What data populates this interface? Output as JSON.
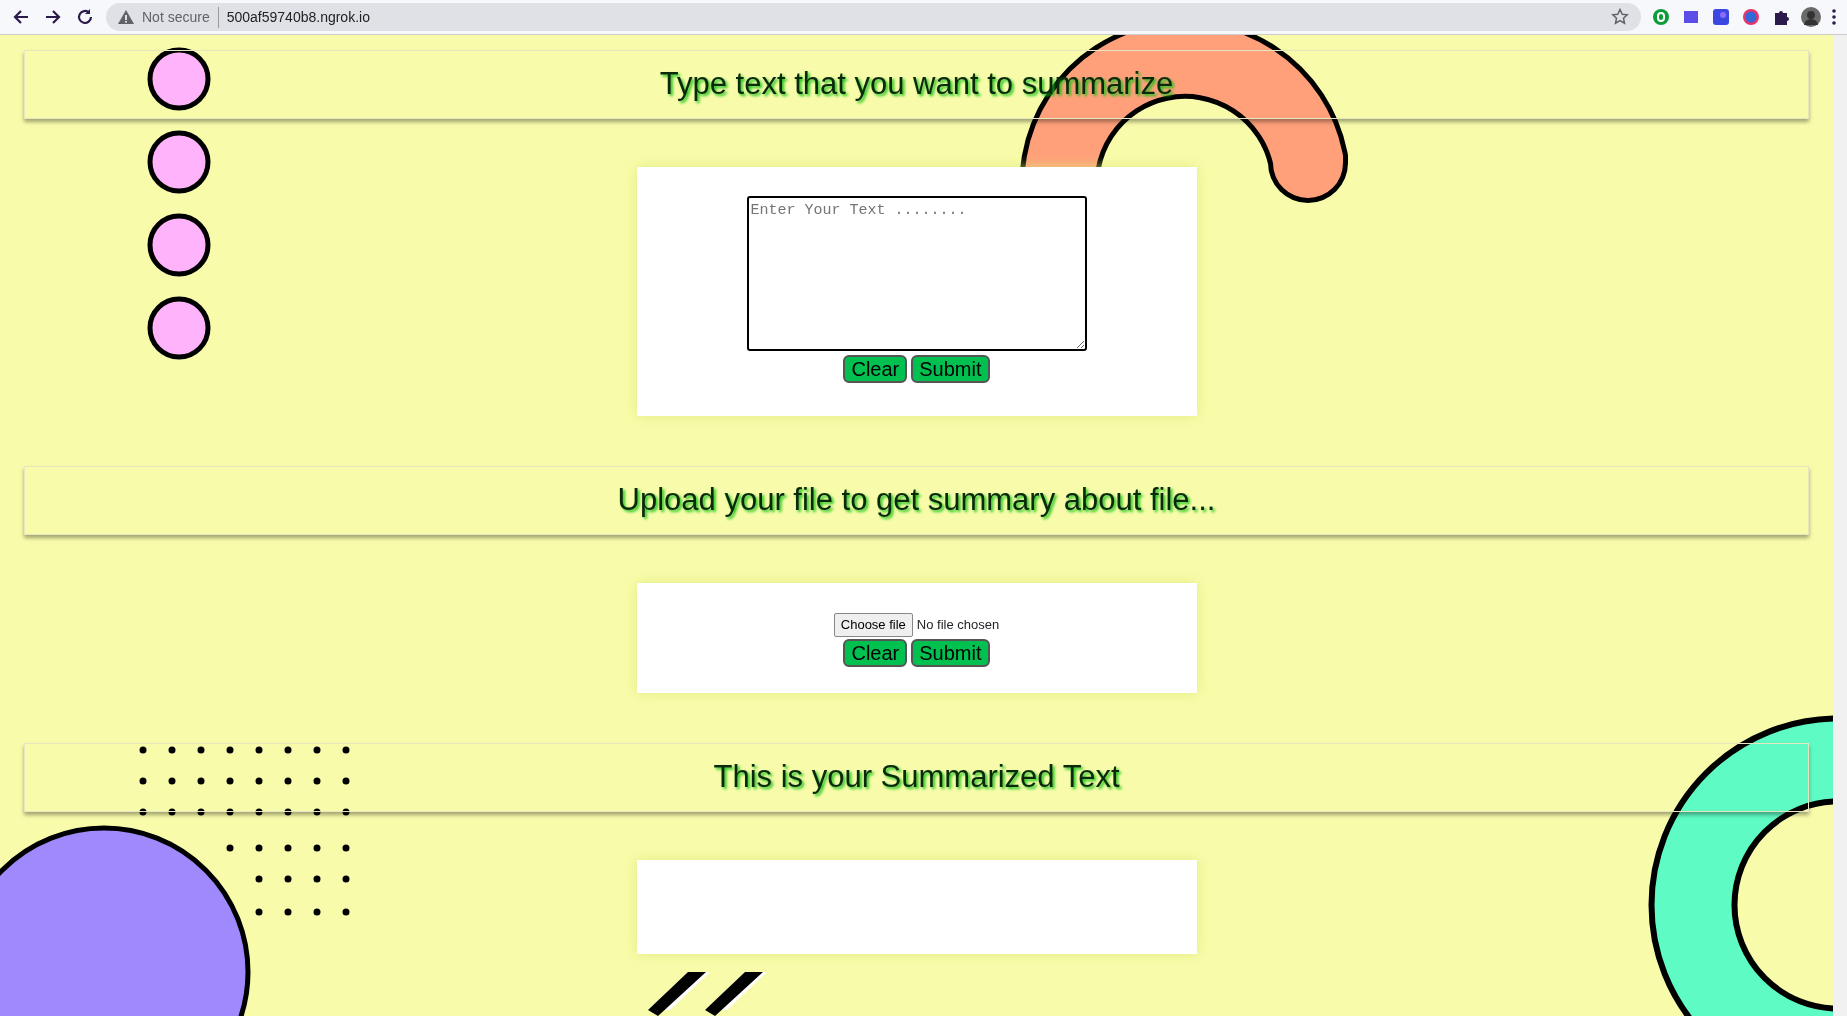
{
  "browser": {
    "security_label": "Not secure",
    "url": "500af59740b8.ngrok.io"
  },
  "sections": [
    {
      "kind": "text",
      "heading": "Type text that you want to summarize",
      "placeholder": "Enter Your Text ........",
      "buttons": [
        "Clear",
        "Submit"
      ]
    },
    {
      "kind": "file",
      "heading": "Upload your file to get summary about file...",
      "file_button": "Choose file",
      "file_status": "No file chosen",
      "buttons": [
        "Clear",
        "Submit"
      ]
    },
    {
      "kind": "output",
      "heading": "This is your Summarized Text"
    }
  ]
}
